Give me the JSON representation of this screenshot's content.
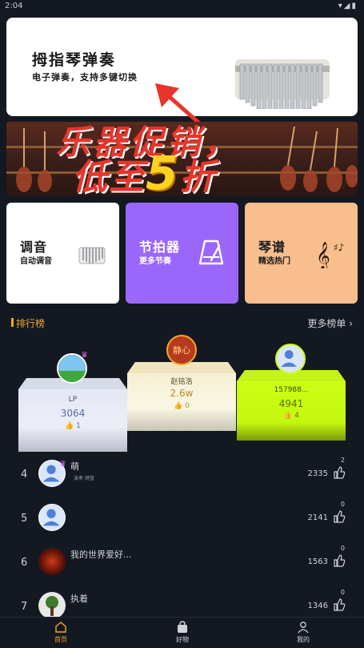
{
  "status_bar": {
    "time": "2:04",
    "icons": "▾◢▮"
  },
  "banner": {
    "title": "拇指琴弹奏",
    "subtitle": "电子弹奏，支持多键切换"
  },
  "promo": {
    "line1": "乐器促销，",
    "line2_prefix": "低至",
    "line2_number": "5",
    "line2_suffix": "折"
  },
  "features": [
    {
      "title": "调音",
      "subtitle": "自动调音",
      "icon": "kalimba-icon"
    },
    {
      "title": "节拍器",
      "subtitle": "更多节奏",
      "icon": "metronome-icon"
    },
    {
      "title": "琴谱",
      "subtitle": "精选热门",
      "icon": "music-note-icon"
    }
  ],
  "ranking": {
    "title": "排行榜",
    "more": "更多榜单 ›",
    "podium": [
      {
        "rank": 2,
        "name": "LP",
        "score": "3064",
        "likes": "1"
      },
      {
        "rank": 1,
        "name": "赵铭浩",
        "score": "2.6w",
        "likes": "0",
        "avatar_text": "静心"
      },
      {
        "rank": 3,
        "name": "157988...",
        "score": "4941",
        "likes": "4"
      }
    ],
    "list": [
      {
        "rank": "4",
        "name": "萌",
        "tag": "演奏·键盘",
        "score": "2335",
        "likes": "2"
      },
      {
        "rank": "5",
        "name": "",
        "tag": "",
        "score": "2141",
        "likes": "0"
      },
      {
        "rank": "6",
        "name": "我的世界爱好...",
        "tag": "",
        "score": "1563",
        "likes": "0"
      },
      {
        "rank": "7",
        "name": "执着",
        "tag": "",
        "score": "1346",
        "likes": "0"
      }
    ]
  },
  "tabbar": [
    {
      "label": "首页",
      "icon": "home-icon",
      "active": true
    },
    {
      "label": "好物",
      "icon": "bag-icon",
      "active": false
    },
    {
      "label": "我的",
      "icon": "user-icon",
      "active": false
    }
  ],
  "colors": {
    "accent": "#f0a82a",
    "background": "#141821",
    "purple": "#9b67fb",
    "peach": "#f8be8d",
    "lime": "#ccff14"
  }
}
